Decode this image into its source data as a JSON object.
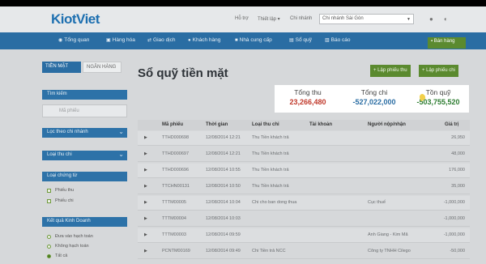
{
  "header": {
    "logo": "KiotViet",
    "links": [
      "Hỗ trợ",
      "Thiết lập ▾",
      "Chi nhánh"
    ],
    "branch_value": "Chi nhánh Sài Gòn"
  },
  "nav": {
    "items": [
      "Tổng quan",
      "Hàng hóa",
      "Giao dịch",
      "Khách hàng",
      "Nhà cung cấp",
      "Sổ quỹ",
      "Báo cáo"
    ],
    "sell_label": "Bán hàng"
  },
  "sidebar": {
    "tab_cash": "TIỀN MẶT",
    "tab_bank": "NGÂN HÀNG",
    "search_header": "Tìm kiếm",
    "search_placeholder": "Mã phiếu",
    "branch_filter": "Lọc theo chi nhánh",
    "type_filter": "Loại thu chi",
    "voucher_type": "Loại chứng từ",
    "voucher_options": [
      "Phiếu thu",
      "Phiếu chi"
    ],
    "business_result": "Kết quả Kinh Doanh",
    "business_options": [
      "Đưa vào hạch toán",
      "Không hạch toán",
      "Tất cả"
    ]
  },
  "main": {
    "title": "Sổ quỹ tiền mặt",
    "btn_receipt": "+ Lập phiếu thu",
    "btn_payment": "+ Lập phiếu chi"
  },
  "summary": {
    "total_in_label": "Tổng thu",
    "total_in_value": "23,266,480",
    "total_out_label": "Tổng chi",
    "total_out_value": "-527,022,000",
    "balance_label": "Tồn quỹ",
    "balance_value": "-503,755,520",
    "colors": {
      "in": "#c0392b",
      "out": "#2a6da3",
      "balance": "#2e7d32"
    }
  },
  "table": {
    "headers": [
      "Mã phiếu",
      "Thời gian",
      "Loại thu chi",
      "Tài khoản",
      "Người nộp/nhận",
      "Giá trị"
    ],
    "rows": [
      [
        "TTHD000698",
        "12/08/2014 12:21",
        "Thu Tiền khách trả",
        "",
        "",
        "26,950"
      ],
      [
        "TTHD000697",
        "12/08/2014 12:21",
        "Thu Tiền khách trả",
        "",
        "",
        "48,000"
      ],
      [
        "TTHD000696",
        "12/08/2014 10:55",
        "Thu Tiền khách trả",
        "",
        "",
        "176,000"
      ],
      [
        "TTCHN00131",
        "12/08/2014 10:50",
        "Thu Tiền khách trả",
        "",
        "",
        "35,000"
      ],
      [
        "TTTM00005",
        "12/08/2014 10:04",
        "Chi cho ban dong thua",
        "",
        "Cục thuế",
        "-1,000,000"
      ],
      [
        "TTTM00004",
        "12/08/2014 10:03",
        "",
        "",
        "",
        "-1,000,000"
      ],
      [
        "TTTM00003",
        "12/08/2014 09:59",
        "",
        "",
        "Anh Giang - Kim Mã",
        "-1,000,000"
      ],
      [
        "PCNTM00169",
        "12/08/2014 09:49",
        "Chi Tiền trả NCC",
        "",
        "Công ty TNHH Cilego",
        "-50,000"
      ]
    ]
  }
}
